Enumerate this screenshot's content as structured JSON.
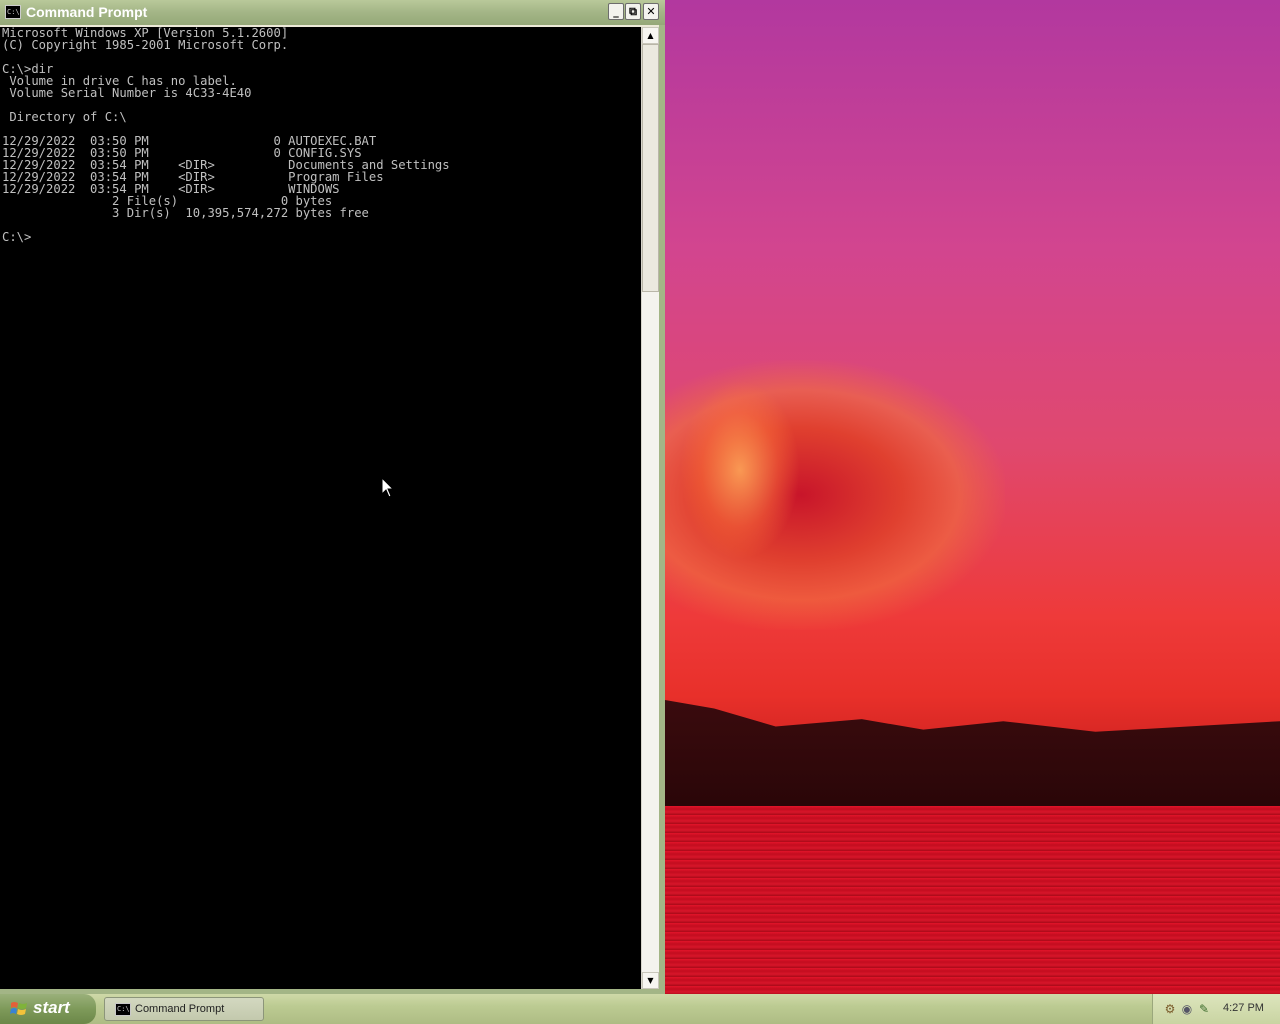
{
  "window": {
    "title": "Command Prompt",
    "icon": "cmd-icon",
    "icon_glyph": "C:\\",
    "buttons": {
      "minimize": "_",
      "maximize": "⧉",
      "close": "✕"
    }
  },
  "console": {
    "lines": [
      "Microsoft Windows XP [Version 5.1.2600]",
      "(C) Copyright 1985-2001 Microsoft Corp.",
      "",
      "C:\\>dir",
      " Volume in drive C has no label.",
      " Volume Serial Number is 4C33-4E40",
      "",
      " Directory of C:\\",
      "",
      "12/29/2022  03:50 PM                 0 AUTOEXEC.BAT",
      "12/29/2022  03:50 PM                 0 CONFIG.SYS",
      "12/29/2022  03:54 PM    <DIR>          Documents and Settings",
      "12/29/2022  03:54 PM    <DIR>          Program Files",
      "12/29/2022  03:54 PM    <DIR>          WINDOWS",
      "               2 File(s)              0 bytes",
      "               3 Dir(s)  10,395,574,272 bytes free",
      "",
      "C:\\>"
    ]
  },
  "taskbar": {
    "start_label": "start",
    "tasks": [
      {
        "label": "Command Prompt",
        "icon": "cmd-icon"
      }
    ],
    "tray_icons": [
      "network-icon",
      "volume-icon",
      "security-icon"
    ],
    "clock": "4:27 PM"
  },
  "colors": {
    "console_bg": "#000000",
    "console_fg": "#c0c0c0",
    "titlebar": "#a3b586",
    "taskbar": "#bccb92"
  }
}
